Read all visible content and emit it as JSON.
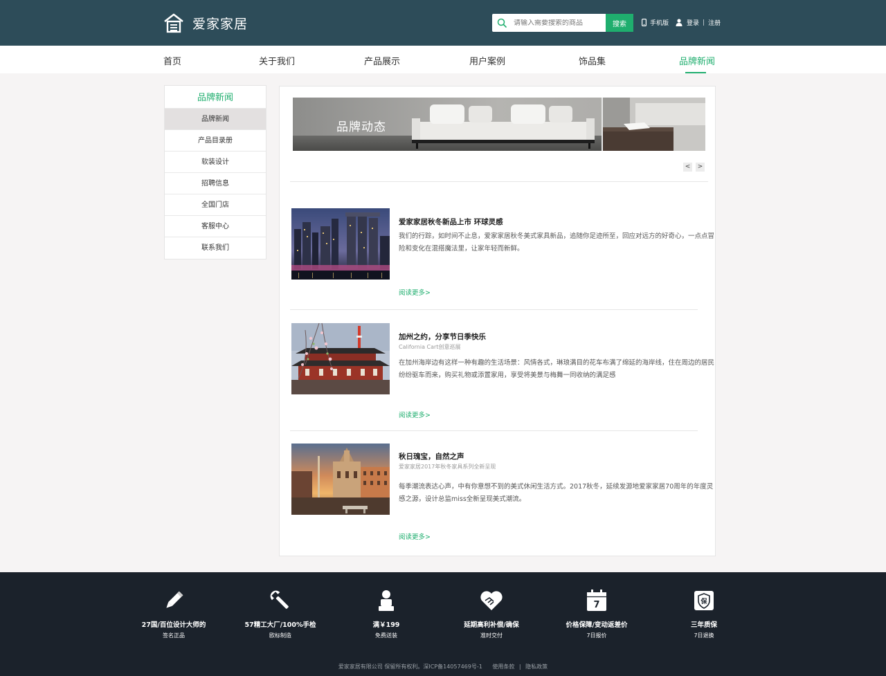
{
  "brand": {
    "name": "爱家家居"
  },
  "header": {
    "search_placeholder": "请输入需要搜索的商品",
    "search_button": "搜索",
    "mobile": "手机版",
    "login": "登录",
    "separator": "|",
    "register": "注册"
  },
  "nav": {
    "items": [
      {
        "label": "首页"
      },
      {
        "label": "关于我们"
      },
      {
        "label": "产品展示"
      },
      {
        "label": "用户案例"
      },
      {
        "label": "饰品集"
      },
      {
        "label": "品牌新闻"
      }
    ],
    "active_index": 5
  },
  "sidebar": {
    "title": "品牌新闻",
    "items": [
      {
        "label": "品牌新闻"
      },
      {
        "label": "产品目录册"
      },
      {
        "label": "软装设计"
      },
      {
        "label": "招聘信息"
      },
      {
        "label": "全国门店"
      },
      {
        "label": "客服中心"
      },
      {
        "label": "联系我们"
      }
    ],
    "active_index": 0
  },
  "banner": {
    "text": "品牌动态",
    "prev": "<",
    "next": ">"
  },
  "articles": [
    {
      "title": "爱家家居秋冬新品上市 环球灵感",
      "subtitle": "",
      "desc": "我们的行踪，如时间不止息，爱家家居秋冬美式家具新品，追随你足迹所至，回应对远方的好奇心，一点点冒险和变化在混搭魔法里，让家年轻而新鲜。",
      "more": "阅读更多>"
    },
    {
      "title": "加州之约，分享节日季快乐",
      "subtitle": "California Cart创意巡展",
      "desc": "在加州海岸边有这样一种有趣的生活场景：风情各式，琳琅满目的花车布满了绵延的海岸线，住在周边的居民纷纷驱车而来，购买礼物或添置家用，享受将美景与梅舞一同收纳的满足感",
      "more": "阅读更多>"
    },
    {
      "title": "秋日瑰宝，自然之声",
      "subtitle": "爱家家居2017年秋冬家具系列全新呈现",
      "desc": "每季潮流表达心声，中有你意想不到的美式休闲生活方式。2017秋冬，延续发源地爱家家居70周年的年度灵感之源，设计总监miss全新呈现美式潮流。",
      "more": "阅读更多>"
    }
  ],
  "features": [
    {
      "icon": "pencil-icon",
      "title": "27国/百位设计大师的",
      "sub": "签名正品"
    },
    {
      "icon": "wrench-icon",
      "title": "57精工大厂/100%手检",
      "sub": "欧标制造"
    },
    {
      "icon": "person-icon",
      "title": "满￥199",
      "sub": "免费送装"
    },
    {
      "icon": "handshake-icon",
      "title": "延期高利补偿/确保",
      "sub": "准时交付"
    },
    {
      "icon": "calendar-icon",
      "title": "价格保障/变动返差价",
      "sub": "7日报价",
      "number": "7"
    },
    {
      "icon": "shield-icon",
      "title": "三年质保",
      "sub": "7日退换",
      "glyph": "保"
    }
  ],
  "footer": {
    "copyright": "爱家家居有限公司 保留所有权利。深ICP备14057469号-1",
    "terms": "使用条款",
    "separator": "|",
    "privacy": "隐私政策"
  },
  "colors": {
    "header_bg": "#2d4c59",
    "accent": "#1fae6e",
    "footer_bg": "#1b222b"
  }
}
